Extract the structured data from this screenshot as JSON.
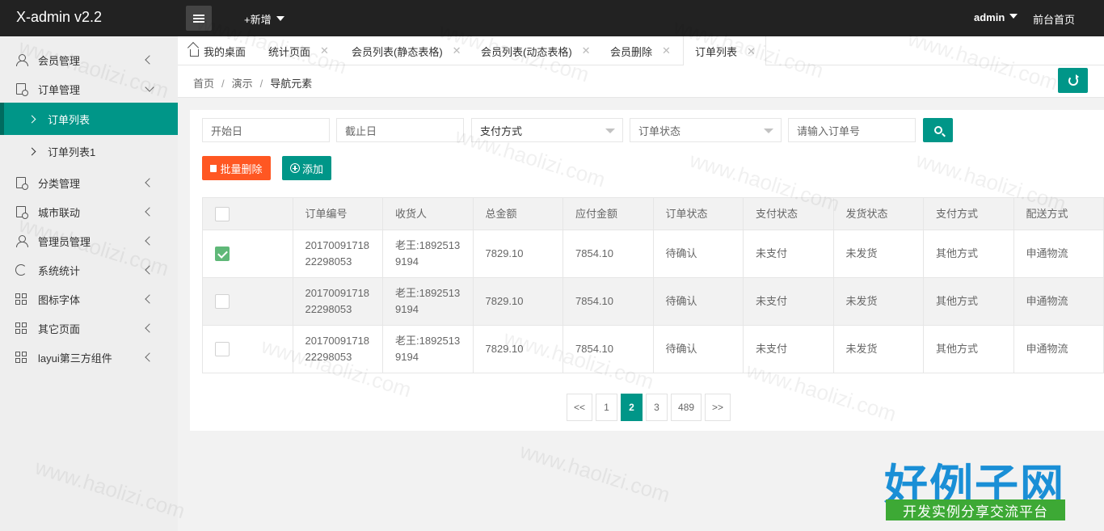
{
  "header": {
    "logo": "X-admin v2.2",
    "add_new": "+新增",
    "user": "admin",
    "front_home": "前台首页"
  },
  "sidebar": {
    "items": [
      {
        "label": "会员管理",
        "icon": "user-icon"
      },
      {
        "label": "订单管理",
        "icon": "order-icon"
      },
      {
        "label": "分类管理",
        "icon": "order-icon"
      },
      {
        "label": "城市联动",
        "icon": "order-icon"
      },
      {
        "label": "管理员管理",
        "icon": "user-icon"
      },
      {
        "label": "系统统计",
        "icon": "cycle-icon"
      },
      {
        "label": "图标字体",
        "icon": "grid-icon"
      },
      {
        "label": "其它页面",
        "icon": "grid-icon"
      },
      {
        "label": "layui第三方组件",
        "icon": "grid-icon"
      }
    ],
    "sub_items": [
      {
        "label": "订单列表",
        "active": true
      },
      {
        "label": "订单列表1",
        "active": false
      }
    ]
  },
  "tabs": [
    {
      "label": "我的桌面"
    },
    {
      "label": "统计页面"
    },
    {
      "label": "会员列表(静态表格)"
    },
    {
      "label": "会员列表(动态表格)"
    },
    {
      "label": "会员删除"
    },
    {
      "label": "订单列表"
    }
  ],
  "tab_close": "✕",
  "breadcrumb": [
    "首页",
    "演示",
    "导航元素"
  ],
  "breadcrumb_sep": "/",
  "filters": {
    "start_placeholder": "开始日",
    "end_placeholder": "截止日",
    "pay_method": "支付方式",
    "order_status": "订单状态",
    "order_no_placeholder": "请输入订单号"
  },
  "buttons": {
    "batch_delete": "批量删除",
    "add": "添加"
  },
  "table": {
    "headers": [
      "订单编号",
      "收货人",
      "总金额",
      "应付金额",
      "订单状态",
      "支付状态",
      "发货状态",
      "支付方式",
      "配送方式"
    ],
    "rows": [
      {
        "checked": true,
        "cells": [
          "2017009171822298053",
          "老王:18925139194",
          "7829.10",
          "7854.10",
          "待确认",
          "未支付",
          "未发货",
          "其他方式",
          "申通物流"
        ]
      },
      {
        "checked": false,
        "cells": [
          "2017009171822298053",
          "老王:18925139194",
          "7829.10",
          "7854.10",
          "待确认",
          "未支付",
          "未发货",
          "其他方式",
          "申通物流"
        ]
      },
      {
        "checked": false,
        "cells": [
          "2017009171822298053",
          "老王:18925139194",
          "7829.10",
          "7854.10",
          "待确认",
          "未支付",
          "未发货",
          "其他方式",
          "申通物流"
        ]
      }
    ]
  },
  "pagination": {
    "prev": "<<",
    "pages": [
      "1",
      "2",
      "3",
      "489"
    ],
    "current": "2",
    "next": ">>"
  },
  "watermark": "www.haolizi.com",
  "brand": {
    "title": "好例子网",
    "subtitle": "开发实例分享交流平台"
  },
  "colors": {
    "accent": "#009688",
    "danger": "#ff5722",
    "header_bg": "#222222",
    "checkbox_on": "#5fb878"
  }
}
